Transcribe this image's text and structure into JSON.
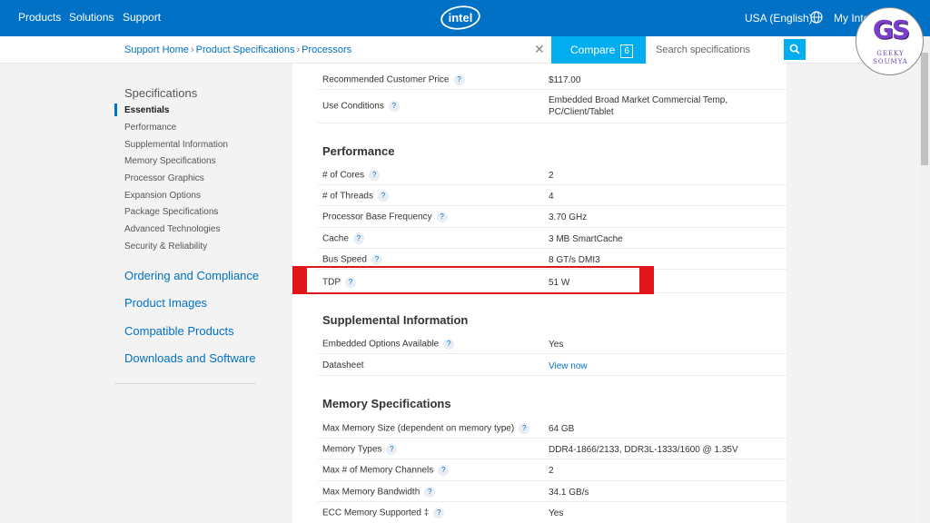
{
  "nav": {
    "products": "Products",
    "solutions": "Solutions",
    "support": "Support",
    "logo": "intel",
    "region": "USA (English)",
    "my_intel": "My Intel"
  },
  "breadcrumb": {
    "home": "Support Home",
    "specs": "Product Specifications",
    "processors": "Processors"
  },
  "compare": {
    "label": "Compare",
    "count": "6"
  },
  "search": {
    "placeholder": "Search specifications"
  },
  "watermark": {
    "letters": "GS",
    "line1": "GEEKY",
    "line2": "SOUMYA"
  },
  "sidebar": {
    "heading": "Specifications",
    "items": [
      "Essentials",
      "Performance",
      "Supplemental Information",
      "Memory Specifications",
      "Processor Graphics",
      "Expansion Options",
      "Package Specifications",
      "Advanced Technologies",
      "Security & Reliability"
    ],
    "links": [
      "Ordering and Compliance",
      "Product Images",
      "Compatible Products",
      "Downloads and Software"
    ]
  },
  "essentials": {
    "price_label": "Recommended Customer Price",
    "price_value": "$117.00",
    "use_label": "Use Conditions",
    "use_value": "Embedded Broad Market Commercial Temp, PC/Client/Tablet"
  },
  "performance": {
    "title": "Performance",
    "rows": [
      {
        "label": "# of Cores",
        "value": "2"
      },
      {
        "label": "# of Threads",
        "value": "4"
      },
      {
        "label": "Processor Base Frequency",
        "value": "3.70 GHz"
      },
      {
        "label": "Cache",
        "value": "3 MB SmartCache"
      },
      {
        "label": "Bus Speed",
        "value": "8 GT/s DMI3"
      },
      {
        "label": "TDP",
        "value": "51 W"
      }
    ]
  },
  "supplemental": {
    "title": "Supplemental Information",
    "rows": [
      {
        "label": "Embedded Options Available",
        "value": "Yes"
      },
      {
        "label": "Datasheet",
        "value": "View now"
      }
    ]
  },
  "memory": {
    "title": "Memory Specifications",
    "rows": [
      {
        "label": "Max Memory Size (dependent on memory type)",
        "value": "64 GB"
      },
      {
        "label": "Memory Types",
        "value": "DDR4-1866/2133, DDR3L-1333/1600 @ 1.35V"
      },
      {
        "label": "Max # of Memory Channels",
        "value": "2"
      },
      {
        "label": "Max Memory Bandwidth",
        "value": "34.1 GB/s"
      },
      {
        "label": "ECC Memory Supported ‡",
        "value": "Yes"
      }
    ]
  },
  "help_glyph": "?",
  "colors": {
    "nav": "#0071c5",
    "accent": "#00aeef",
    "highlight": "#e0161b"
  }
}
